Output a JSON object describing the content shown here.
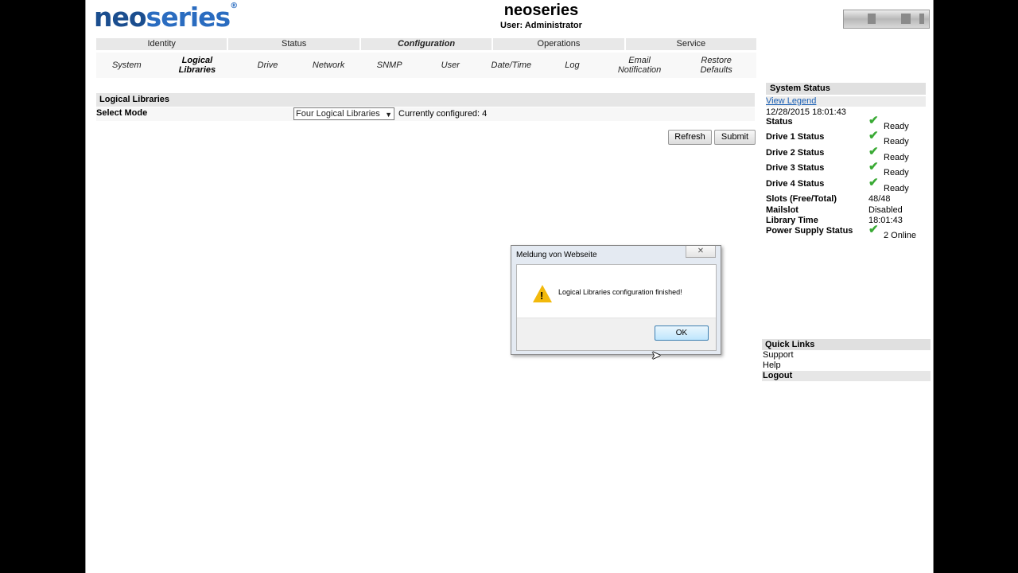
{
  "header": {
    "logo_neo": "neo",
    "logo_series": "series",
    "logo_reg": "®",
    "title": "neoseries",
    "user": "User: Administrator"
  },
  "tabs": [
    {
      "label": "Identity",
      "active": false
    },
    {
      "label": "Status",
      "active": false
    },
    {
      "label": "Configuration",
      "active": true
    },
    {
      "label": "Operations",
      "active": false
    },
    {
      "label": "Service",
      "active": false
    }
  ],
  "subnav": [
    {
      "label": "System",
      "active": false
    },
    {
      "label": "Logical Libraries",
      "active": true
    },
    {
      "label": "Drive",
      "active": false
    },
    {
      "label": "Network",
      "active": false
    },
    {
      "label": "SNMP",
      "active": false
    },
    {
      "label": "User",
      "active": false
    },
    {
      "label": "Date/Time",
      "active": false
    },
    {
      "label": "Log",
      "active": false
    },
    {
      "label": "Email Notification",
      "active": false
    },
    {
      "label": "Restore Defaults",
      "active": false
    }
  ],
  "logical_libraries": {
    "title": "Logical Libraries",
    "select_mode_label": "Select Mode",
    "selected_mode": "Four Logical Libraries",
    "configured_text": "Currently configured: 4"
  },
  "buttons": {
    "refresh": "Refresh",
    "submit": "Submit"
  },
  "system_status": {
    "title": "System Status",
    "view_legend": "View Legend",
    "timestamp": "12/28/2015 18:01:43",
    "rows": [
      {
        "label": "Status",
        "value": "Ready",
        "check": true
      },
      {
        "label": "Drive 1 Status",
        "value": "Ready",
        "check": true
      },
      {
        "label": "Drive 2 Status",
        "value": "Ready",
        "check": true
      },
      {
        "label": "Drive 3 Status",
        "value": "Ready",
        "check": true
      },
      {
        "label": "Drive 4 Status",
        "value": "Ready",
        "check": true
      },
      {
        "label": "Slots (Free/Total)",
        "value": "48/48",
        "check": false
      },
      {
        "label": "Mailslot",
        "value": "Disabled",
        "check": false
      },
      {
        "label": "Library Time",
        "value": "18:01:43",
        "check": false
      },
      {
        "label": "Power Supply Status",
        "value": "2 Online",
        "check": true
      }
    ]
  },
  "quick_links": {
    "title": "Quick Links",
    "support": "Support",
    "help": "Help",
    "logout": "Logout"
  },
  "dialog": {
    "title": "Meldung von Webseite",
    "close": "✕",
    "message": "Logical Libraries configuration finished!",
    "ok": "OK",
    "warning_glyph": "!"
  },
  "colors": {
    "brand_blue": "#1b4e8f",
    "check_green": "#3aaa35",
    "link_blue": "#1a5fb4"
  }
}
